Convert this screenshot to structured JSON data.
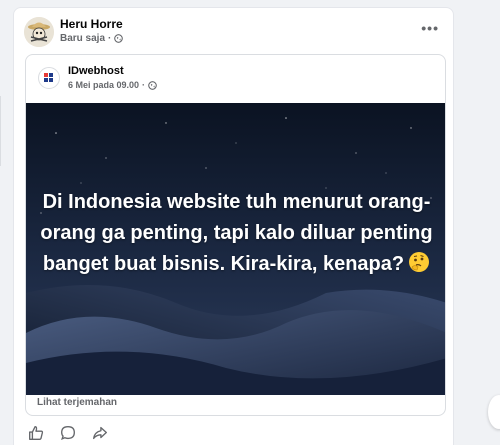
{
  "post": {
    "author": "Heru Horre",
    "timestamp": "Baru saja",
    "privacy_icon": "globe-icon",
    "more_icon": "more-horizontal-icon"
  },
  "shared_post": {
    "page_name": "IDwebhost",
    "timestamp": "6 Mei pada 09.00",
    "privacy_icon": "globe-icon",
    "image_text": "Di Indonesia website tuh menurut orang-orang ga penting, tapi kalo diluar penting banget buat bisnis. Kira-kira, kenapa?",
    "emoji": "🤔",
    "see_translation": "Lihat terjemahan"
  },
  "actions": [
    {
      "name": "like",
      "icon": "thumbs-up-icon"
    },
    {
      "name": "comment",
      "icon": "comment-icon"
    },
    {
      "name": "share",
      "icon": "share-icon"
    }
  ],
  "colors": {
    "background": "#f0f2f5",
    "card": "#ffffff",
    "text_primary": "#050505",
    "text_secondary": "#65676b",
    "image_dark": "#0c1424"
  }
}
